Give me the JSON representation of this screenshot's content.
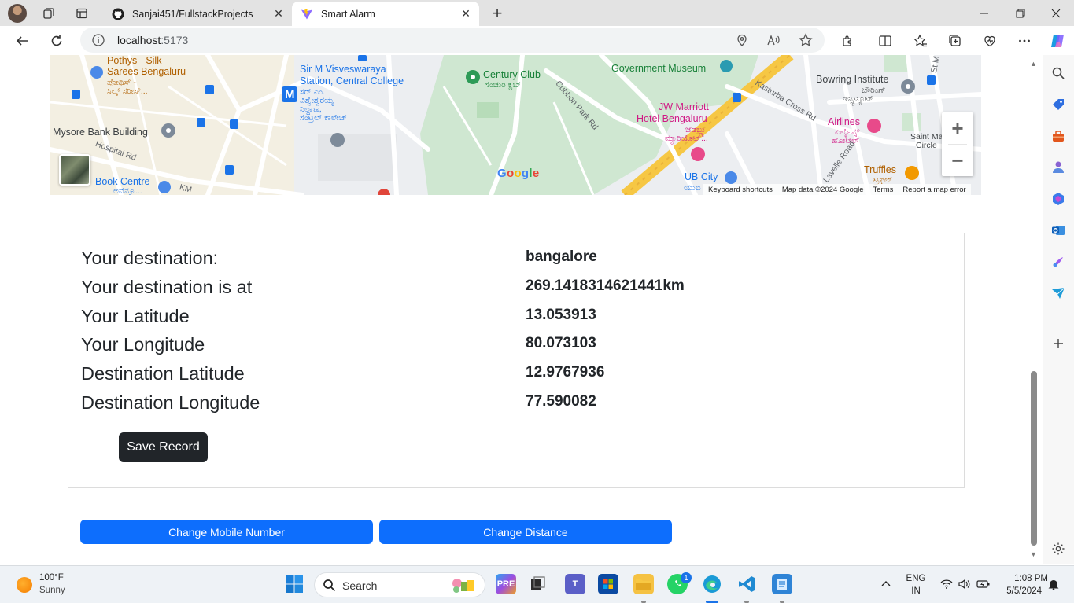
{
  "browser": {
    "tabs": [
      {
        "title": "Sanjai451/FullstackProjects",
        "active": false
      },
      {
        "title": "Smart Alarm",
        "active": true
      }
    ],
    "address": {
      "host": "localhost",
      "port": ":5173"
    }
  },
  "map": {
    "labels": {
      "pothys": "Pothys - Silk",
      "pothys2": "Sarees Bengaluru",
      "pothys_kn": "ಪೋಥಿಸ್ -",
      "pothys_kn2": "ಸಿಲ್ಕ್ ಸರೀಸ್...",
      "visveswaraya": "Sir M Visveswaraya",
      "visveswaraya2": "Station, Central College",
      "visveswaraya_kn": "ಸರ್ ಎಂ.",
      "visveswaraya_kn2": "ವಿಶ್ವೇಶ್ವರಯ್ಯ",
      "visveswaraya_kn3": "ನಿಲ್ದಾಣ,",
      "visveswaraya_kn4": "ಸೆಂಟ್ರಲ್ ಕಾಲೇಜ್",
      "mysore_bank": "Mysore Bank Building",
      "hospital_rd": "Hospital Rd",
      "book_centre": "Book Centre",
      "book_centre_kn": "ಅವೆನ್ಯೂ...",
      "km_rd": "KM",
      "century_club": "Century Club",
      "century_club_kn": "ಸೆಂಚುರಿ ಕ್ಲಬ್",
      "cubbon_park_rd": "Cubbon Park Rd",
      "govt_museum": "Government Museum",
      "jw_marriott": "JW Marriott",
      "jw_marriott2": "Hotel Bengaluru",
      "jw_marriott_kn": "ಜೆಡಬ್ಲ್ಯು",
      "jw_marriott_kn2": "ಮ್ಯಾರಿಯೊಟ್...",
      "ub_city": "UB City",
      "ub_city_kn": "ಯುಬಿ",
      "kasturba": "Kasturba Cross Rd",
      "bowring": "Bowring Institute",
      "bowring_kn": "ಬೌರಿಂಗ್",
      "bowring_kn2": "ಇನ್ಸ್ಟಿಟ್ಯೂಟ್",
      "airlines": "Airlines",
      "airlines_kn": "ಏರ್ಲೈನ್ಸ್",
      "airlines_kn2": "ಹೋಟೆಲ್",
      "saint_mark": "Saint Mark",
      "saint_mark2": "Circle",
      "truffles": "Truffles",
      "truffles_kn": "ಟ್ರಫಲ್",
      "lavelle": "Lavelle Road",
      "st_marks": "St M"
    },
    "google_logo": "Google",
    "zoom_in": "+",
    "zoom_out": "−",
    "attribution": {
      "shortcuts": "Keyboard shortcuts",
      "data": "Map data ©2024 Google",
      "terms": "Terms",
      "report": "Report a map error"
    }
  },
  "info": {
    "rows": [
      {
        "label": "Your destination:",
        "value": "bangalore"
      },
      {
        "label": "Your destination is at",
        "value": "269.1418314621441km"
      },
      {
        "label": "Your Latitude",
        "value": "13.053913"
      },
      {
        "label": "Your Longitude",
        "value": "80.073103"
      },
      {
        "label": "Destination Latitude",
        "value": "12.9767936"
      },
      {
        "label": "Destination Longitude",
        "value": "77.590082"
      }
    ],
    "save_label": "Save Record"
  },
  "actions": {
    "change_mobile": "Change Mobile Number",
    "change_distance": "Change Distance"
  },
  "taskbar": {
    "weather_temp": "100°F",
    "weather_desc": "Sunny",
    "search_placeholder": "Search",
    "whatsapp_badge": "1",
    "lang": "ENG",
    "region": "IN",
    "time": "1:08 PM",
    "date": "5/5/2024"
  },
  "colors": {
    "primary": "#0d6efd",
    "dark_button": "#212529",
    "map_park": "#c8e6c9",
    "map_highway": "#f6c744"
  }
}
